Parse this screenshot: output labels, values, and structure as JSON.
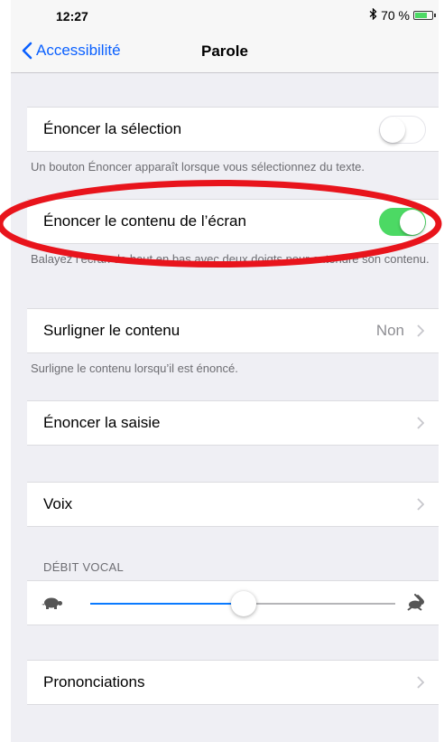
{
  "status_bar": {
    "time": "12:27",
    "bluetooth_icon": "bluetooth-icon",
    "battery_text": "70 %",
    "battery_level": 0.7,
    "battery_color": "#4cd964"
  },
  "nav": {
    "back_label": "Accessibilité",
    "title": "Parole"
  },
  "cells": {
    "speak_selection": {
      "label": "Énoncer la sélection",
      "toggle_on": false,
      "footer": "Un bouton Énoncer apparaît lorsque vous sélectionnez du texte."
    },
    "speak_screen": {
      "label": "Énoncer le contenu de l’écran",
      "toggle_on": true,
      "footer": "Balayez l’écran de haut en bas avec deux doigts pour entendre son contenu."
    },
    "highlight": {
      "label": "Surligner le contenu",
      "value": "Non",
      "footer": "Surligne le contenu lorsqu’il est énoncé."
    },
    "typing_feedback": {
      "label": "Énoncer la saisie"
    },
    "voices": {
      "label": "Voix"
    },
    "speaking_rate": {
      "header": "DÉBIT VOCAL",
      "value_fraction": 0.5,
      "min_icon": "turtle-icon",
      "max_icon": "hare-icon"
    },
    "pronunciations": {
      "label": "Prononciations"
    }
  },
  "colors": {
    "accent": "#0a60ff",
    "toggle_on": "#4cd964",
    "annotation": "#e8141c",
    "background": "#efeff4"
  }
}
